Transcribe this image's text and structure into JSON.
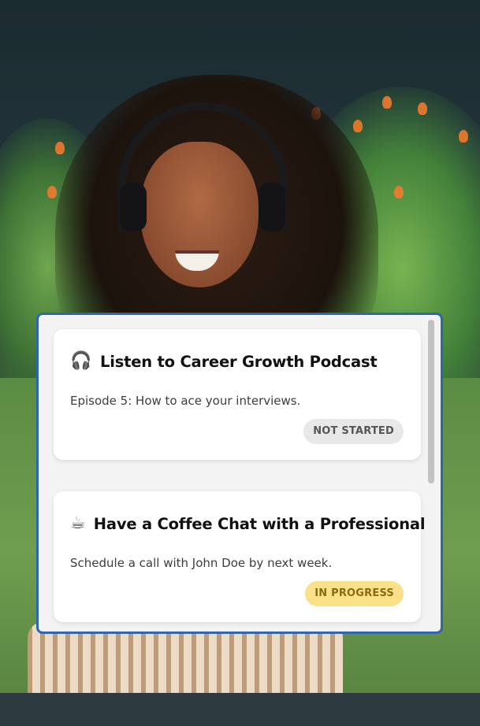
{
  "tasks": [
    {
      "icon": "headphones-icon",
      "icon_glyph": "🎧",
      "title": "Listen to Career Growth Podcast",
      "description": "Episode 5: How to ace your interviews.",
      "status": "NOT STARTED",
      "status_color": "#e8e8e8"
    },
    {
      "icon": "coffee-cup-icon",
      "icon_glyph": "☕",
      "title": "Have a Coffee Chat with a Professional",
      "description": "Schedule a call with John Doe by next week.",
      "status": "IN PROGRESS",
      "status_color": "#fbe08a"
    }
  ],
  "colors": {
    "panel_border": "#2f66b0",
    "panel_background": "#f3f3f3",
    "card_background": "#ffffff"
  }
}
